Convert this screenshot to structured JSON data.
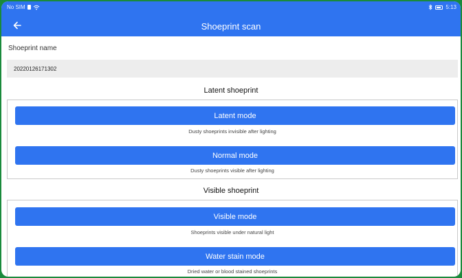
{
  "statusbar": {
    "carrier": "No SIM",
    "time": "5:13"
  },
  "header": {
    "title": "Shoeprint scan"
  },
  "form": {
    "name_label": "Shoeprint name",
    "name_value": "20220126171302"
  },
  "sections": [
    {
      "title": "Latent shoeprint",
      "modes": [
        {
          "label": "Latent mode",
          "description": "Dusty shoeprints invisible after lighting"
        },
        {
          "label": "Normal mode",
          "description": "Dusty shoeprints visible after lighting"
        }
      ]
    },
    {
      "title": "Visible shoeprint",
      "modes": [
        {
          "label": "Visible mode",
          "description": "Shoeprints visible under natural light"
        },
        {
          "label": "Water stain mode",
          "description": "Dried water or blood stained shoeprints"
        }
      ]
    }
  ],
  "colors": {
    "accent": "#2f74f0",
    "frame": "#1a8a3c",
    "field_bg": "#ededed"
  },
  "icons": {
    "back": "arrow-left-icon",
    "wifi": "wifi-icon",
    "bluetooth": "bluetooth-icon",
    "battery": "battery-icon",
    "sim": "sim-icon"
  }
}
